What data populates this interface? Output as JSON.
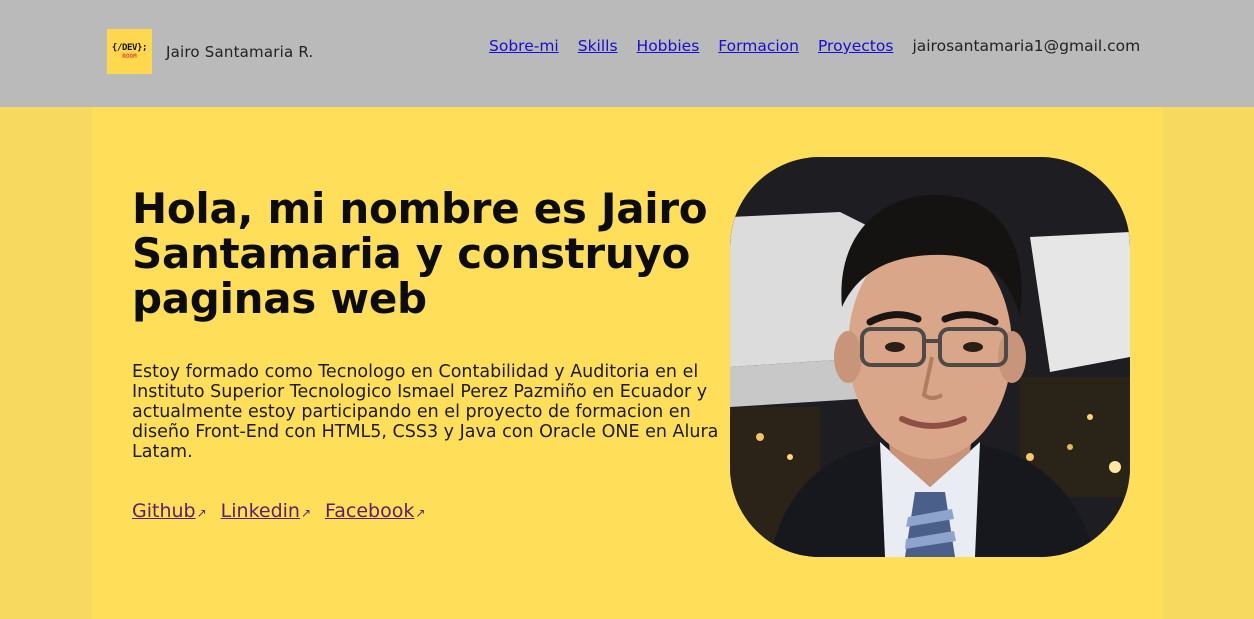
{
  "header": {
    "logo": {
      "main_text": "{/DEV};",
      "sub_text": "ROOM",
      "bg_color": "#ffd84d"
    },
    "site_name": "Jairo Santamaria R.",
    "nav": [
      {
        "label": "Sobre-mi"
      },
      {
        "label": "Skills"
      },
      {
        "label": "Hobbies"
      },
      {
        "label": "Formacion"
      },
      {
        "label": "Proyectos"
      }
    ],
    "email": "jairosantamaria1@gmail.com",
    "bg_color": "#bababa"
  },
  "hero": {
    "headline": "Hola, mi nombre es Jairo Santamaria y construyo paginas web",
    "bio": "Estoy formado como Tecnologo en Contabilidad y Auditoria en el Instituto Superior Tecnologico Ismael Perez Pazmiño en Ecuador y actualmente estoy participando en el proyecto de formacion en diseño Front-End con HTML5, CSS3 y Java con Oracle ONE en Alura Latam.",
    "social": [
      {
        "label": "Github",
        "icon": "external-link-icon"
      },
      {
        "label": "Linkedin",
        "icon": "external-link-icon"
      },
      {
        "label": "Facebook",
        "icon": "external-link-icon"
      }
    ],
    "bg_color": "#ffde59",
    "link_color": "#5b1e6d"
  },
  "colors": {
    "nav_link": "#1a0dcf",
    "page_bg": "#f7d95f"
  }
}
